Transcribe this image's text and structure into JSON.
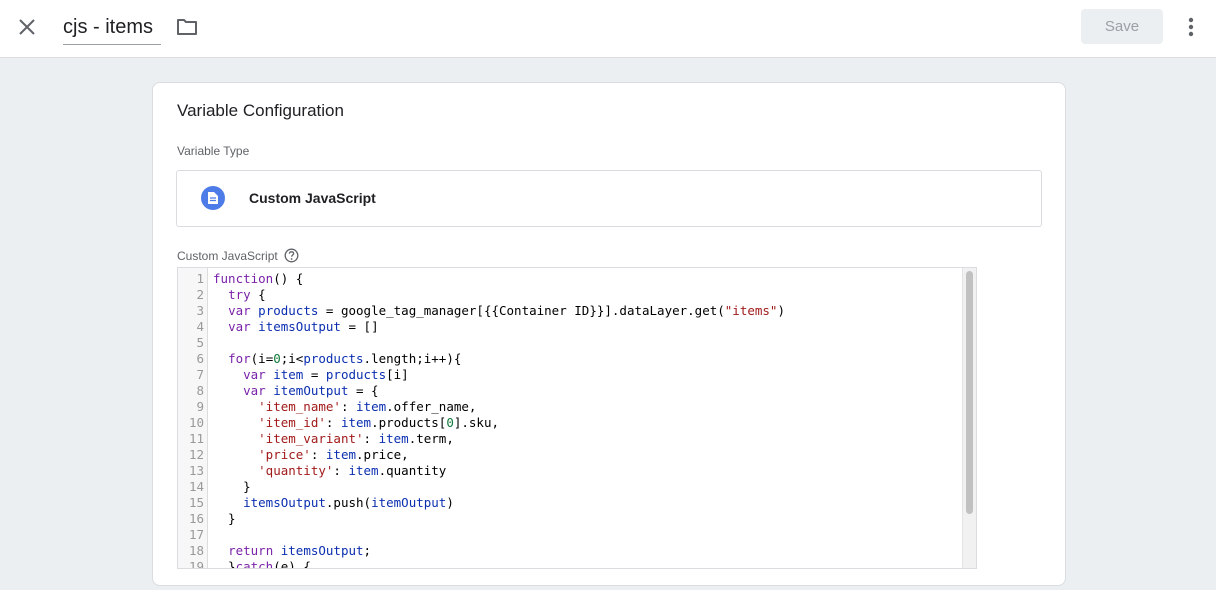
{
  "header": {
    "title": "cjs - items",
    "save_label": "Save"
  },
  "icons": {
    "close": "close-icon",
    "folder": "folder-icon",
    "more": "more-vert-icon",
    "type": "document-icon",
    "help": "help-icon"
  },
  "card": {
    "title": "Variable Configuration",
    "variable_type_label": "Variable Type",
    "variable_type_value": "Custom JavaScript",
    "code_label": "Custom JavaScript"
  },
  "editor": {
    "scroll_fraction_visible": 0.82,
    "lines": [
      [
        [
          "kw",
          "function"
        ],
        [
          "",
          "() {"
        ]
      ],
      [
        [
          "",
          "  "
        ],
        [
          "kw",
          "try"
        ],
        [
          "",
          " {"
        ]
      ],
      [
        [
          "",
          "  "
        ],
        [
          "kw",
          "var"
        ],
        [
          "",
          " "
        ],
        [
          "var",
          "products"
        ],
        [
          "",
          " = google_tag_manager[{{Container ID}}].dataLayer.get("
        ],
        [
          "str",
          "\"items\""
        ],
        [
          "",
          ")"
        ]
      ],
      [
        [
          "",
          "  "
        ],
        [
          "kw",
          "var"
        ],
        [
          "",
          " "
        ],
        [
          "var",
          "itemsOutput"
        ],
        [
          "",
          " = []"
        ]
      ],
      [
        [
          "",
          ""
        ]
      ],
      [
        [
          "",
          "  "
        ],
        [
          "kw",
          "for"
        ],
        [
          "",
          "(i="
        ],
        [
          "num",
          "0"
        ],
        [
          "",
          ";i<"
        ],
        [
          "var",
          "products"
        ],
        [
          "",
          ".length;i++){"
        ]
      ],
      [
        [
          "",
          "    "
        ],
        [
          "kw",
          "var"
        ],
        [
          "",
          " "
        ],
        [
          "var",
          "item"
        ],
        [
          "",
          " = "
        ],
        [
          "var",
          "products"
        ],
        [
          "",
          "[i]"
        ]
      ],
      [
        [
          "",
          "    "
        ],
        [
          "kw",
          "var"
        ],
        [
          "",
          " "
        ],
        [
          "var",
          "itemOutput"
        ],
        [
          "",
          " = {"
        ]
      ],
      [
        [
          "",
          "      "
        ],
        [
          "str",
          "'item_name'"
        ],
        [
          "",
          ": "
        ],
        [
          "var",
          "item"
        ],
        [
          "",
          ".offer_name,"
        ]
      ],
      [
        [
          "",
          "      "
        ],
        [
          "str",
          "'item_id'"
        ],
        [
          "",
          ": "
        ],
        [
          "var",
          "item"
        ],
        [
          "",
          ".products["
        ],
        [
          "num",
          "0"
        ],
        [
          "",
          "].sku,"
        ]
      ],
      [
        [
          "",
          "      "
        ],
        [
          "str",
          "'item_variant'"
        ],
        [
          "",
          ": "
        ],
        [
          "var",
          "item"
        ],
        [
          "",
          ".term,"
        ]
      ],
      [
        [
          "",
          "      "
        ],
        [
          "str",
          "'price'"
        ],
        [
          "",
          ": "
        ],
        [
          "var",
          "item"
        ],
        [
          "",
          ".price,"
        ]
      ],
      [
        [
          "",
          "      "
        ],
        [
          "str",
          "'quantity'"
        ],
        [
          "",
          ": "
        ],
        [
          "var",
          "item"
        ],
        [
          "",
          ".quantity"
        ]
      ],
      [
        [
          "",
          "    }"
        ]
      ],
      [
        [
          "",
          "    "
        ],
        [
          "var",
          "itemsOutput"
        ],
        [
          "",
          ".push("
        ],
        [
          "var",
          "itemOutput"
        ],
        [
          "",
          ")"
        ]
      ],
      [
        [
          "",
          "  }"
        ]
      ],
      [
        [
          "",
          ""
        ]
      ],
      [
        [
          "",
          "  "
        ],
        [
          "kw",
          "return"
        ],
        [
          "",
          " "
        ],
        [
          "var",
          "itemsOutput"
        ],
        [
          "",
          ";"
        ]
      ],
      [
        [
          "",
          "  }"
        ],
        [
          "kw",
          "catch"
        ],
        [
          "",
          "(e) {"
        ]
      ]
    ]
  }
}
